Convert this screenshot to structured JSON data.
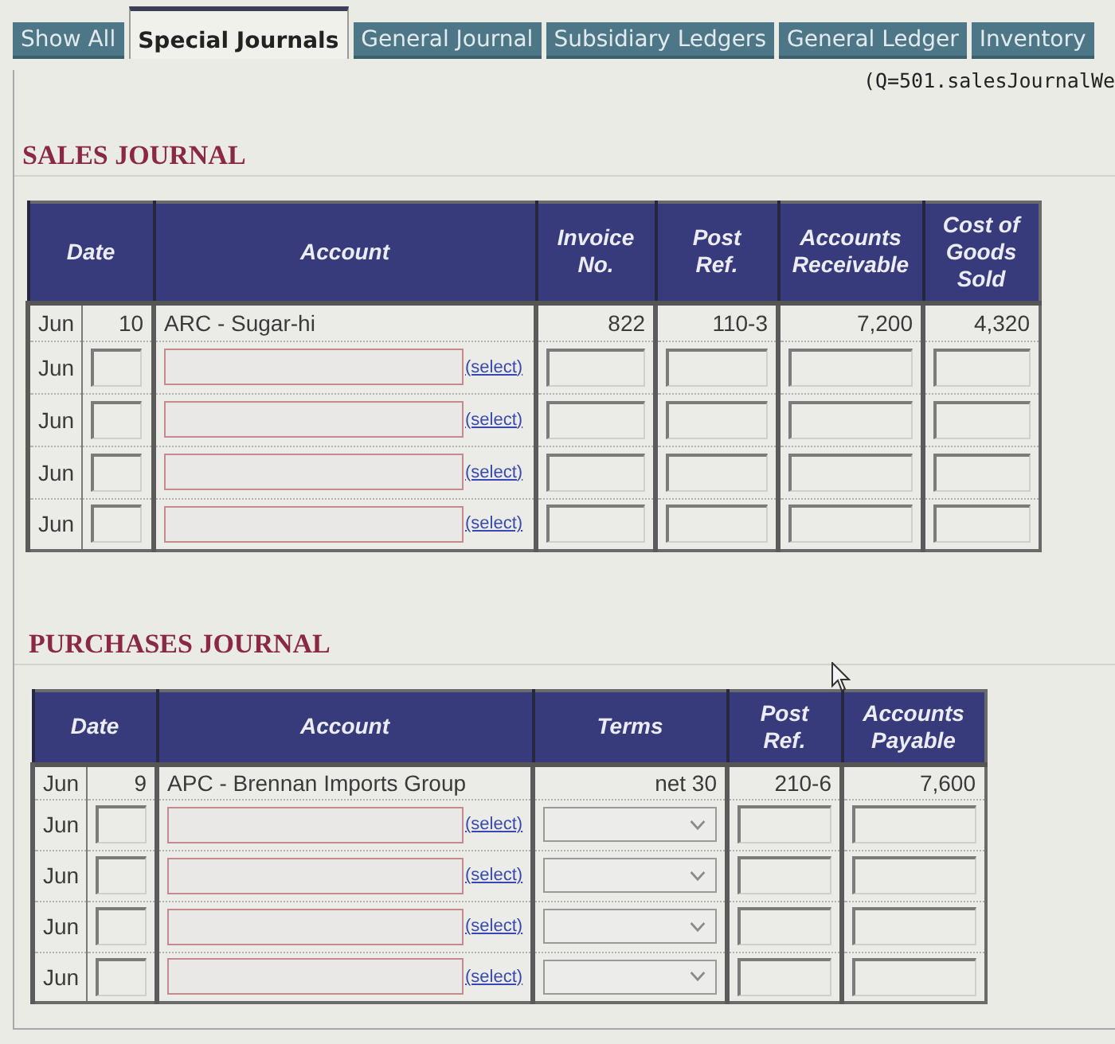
{
  "tabs": [
    {
      "label": "Show All",
      "selected": false
    },
    {
      "label": "Special Journals",
      "selected": true
    },
    {
      "label": "General Journal",
      "selected": false
    },
    {
      "label": "Subsidiary Ledgers",
      "selected": false
    },
    {
      "label": "General Ledger",
      "selected": false
    },
    {
      "label": "Inventory",
      "selected": false
    }
  ],
  "query_label": "(Q=501.salesJournalWe",
  "sales_journal": {
    "title": "SALES JOURNAL",
    "columns": [
      {
        "label": "Date",
        "kind": "date"
      },
      {
        "label": "Account",
        "kind": "account"
      },
      {
        "label": "Invoice No.",
        "kind": "text"
      },
      {
        "label": "Post Ref.",
        "kind": "text"
      },
      {
        "label": "Accounts Receivable",
        "kind": "text"
      },
      {
        "label": "Cost of Goods Sold",
        "kind": "text"
      }
    ],
    "rows": [
      {
        "kind": "posted",
        "month": "Jun",
        "day": "10",
        "account": "ARC - Sugar-hi",
        "values": [
          "822",
          "110-3",
          "7,200",
          "4,320"
        ]
      },
      {
        "kind": "blank",
        "month": "Jun",
        "link": "(select)"
      },
      {
        "kind": "blank",
        "month": "Jun",
        "link": "(select)"
      },
      {
        "kind": "blank",
        "month": "Jun",
        "link": "(select)"
      },
      {
        "kind": "blank",
        "month": "Jun",
        "link": "(select)"
      }
    ]
  },
  "purchases_journal": {
    "title": "PURCHASES JOURNAL",
    "columns": [
      {
        "label": "Date",
        "kind": "date"
      },
      {
        "label": "Account",
        "kind": "account"
      },
      {
        "label": "Terms",
        "kind": "dropdown"
      },
      {
        "label": "Post Ref.",
        "kind": "text"
      },
      {
        "label": "Accounts Payable",
        "kind": "text"
      }
    ],
    "rows": [
      {
        "kind": "posted",
        "month": "Jun",
        "day": "9",
        "account": "APC - Brennan Imports Group",
        "values": [
          "net 30",
          "210-6",
          "7,600"
        ]
      },
      {
        "kind": "blank",
        "month": "Jun",
        "link": "(select)"
      },
      {
        "kind": "blank",
        "month": "Jun",
        "link": "(select)"
      },
      {
        "kind": "blank",
        "month": "Jun",
        "link": "(select)"
      },
      {
        "kind": "blank",
        "month": "Jun",
        "link": "(select)"
      }
    ]
  }
}
